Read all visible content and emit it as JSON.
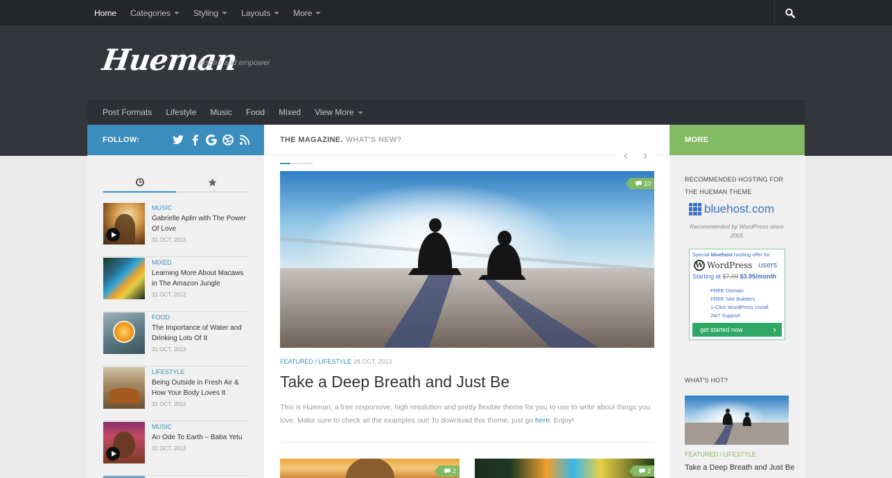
{
  "topnav": {
    "items": [
      {
        "label": "Home",
        "active": true,
        "dropdown": false
      },
      {
        "label": "Categories",
        "dropdown": true
      },
      {
        "label": "Styling",
        "dropdown": true
      },
      {
        "label": "Layouts",
        "dropdown": true
      },
      {
        "label": "More",
        "dropdown": true
      }
    ],
    "search_icon": "search-icon"
  },
  "header": {
    "logo": "Hueman",
    "tagline": "Inspire and empower"
  },
  "subnav": {
    "items": [
      "Post Formats",
      "Lifestyle",
      "Music",
      "Food",
      "Mixed",
      "View More"
    ]
  },
  "left": {
    "follow_label": "FOLLOW:",
    "social_icons": [
      "twitter-icon",
      "facebook-icon",
      "google-icon",
      "dribbble-icon",
      "rss-icon"
    ],
    "tabs": [
      "clock-icon",
      "star-icon"
    ],
    "posts": [
      {
        "category": "MUSIC",
        "title": "Gabrielle Aplin with The Power Of Love",
        "date": "31 OCT, 2013",
        "video": true
      },
      {
        "category": "MIXED",
        "title": "Learning More About Macaws in The Amazon Jungle",
        "date": "31 OCT, 2013",
        "video": false
      },
      {
        "category": "FOOD",
        "title": "The Importance of Water and Drinking Lots Of It",
        "date": "31 OCT, 2013",
        "video": false
      },
      {
        "category": "LIFESTYLE",
        "title": "Being Outside in Fresh Air & How Your Body Loves It",
        "date": "31 OCT, 2013",
        "video": false
      },
      {
        "category": "MUSIC",
        "title": "An Ode To Earth – Baba Yetu",
        "date": "31 OCT, 2013",
        "video": true
      }
    ]
  },
  "main": {
    "heading_a": "THE MAGAZINE.",
    "heading_b": "WHAT'S NEW?",
    "featured": {
      "comments": "10",
      "cat1": "FEATURED",
      "cat_sep": " / ",
      "cat2": "LIFESTYLE",
      "date": "28 OCT, 2013",
      "title": "Take a Deep Breath and Just Be",
      "excerpt": "This is Hueman, a free responsive, high resolution and pretty flexible theme for you to use to write about things you love. Make sure to check all the examples out! To download this theme, just go ",
      "link": "here",
      "excerpt_end": ". Enjoy!"
    },
    "grid_comments": [
      "2",
      "2"
    ]
  },
  "right": {
    "more_label": "MORE",
    "recommended": "RECOMMENDED HOSTING FOR THE HUEMAN THEME",
    "bluehost": "bluehost.com",
    "bluehost_sub": "Recommended by WordPress since 2005",
    "ad": {
      "line1": "Special",
      "line1b": "bluehost",
      "line1c": "hosting offer for",
      "wp": "WordPress",
      "users": "users",
      "starting": "Starting at",
      "old_price": "$7.99",
      "new_price": "$3.95/month",
      "features": [
        "FREE Domain",
        "FREE Site Builders",
        "1-Click WordPress Install",
        "24/7 Support"
      ],
      "button": "get started now"
    },
    "hot_label": "WHAT'S HOT?",
    "hot_cat": "FEATURED / LIFESTYLE",
    "hot_title": "Take a Deep Breath and Just Be"
  }
}
